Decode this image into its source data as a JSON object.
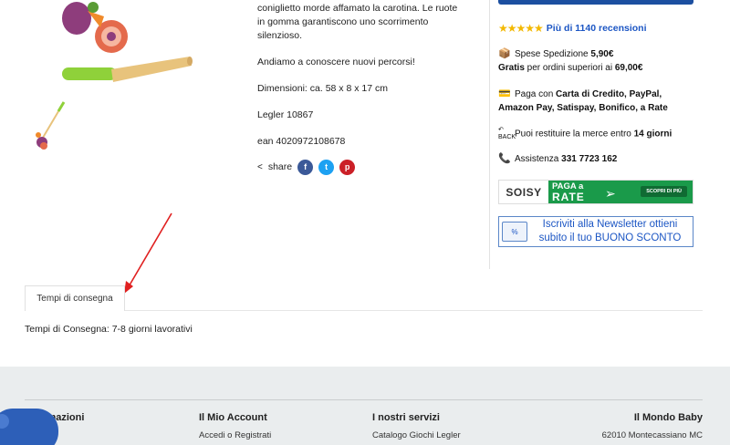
{
  "description": {
    "line1": "coniglietto morde affamato la carotina. Le ruote",
    "line2": "in gomma garantiscono uno scorrimento",
    "line3": "silenzioso.",
    "paragraph_2": "Andiamo a conoscere nuovi percorsi!",
    "dimensions": "Dimensioni: ca. 58 x 8 x 17 cm",
    "brand_code": "Legler 10867",
    "ean": "ean 4020972108678",
    "share_label": "share"
  },
  "social": [
    {
      "name": "facebook",
      "glyph": "f",
      "color": "#3b5998"
    },
    {
      "name": "twitter",
      "glyph": "t",
      "color": "#1da1f2"
    },
    {
      "name": "pinterest",
      "glyph": "p",
      "color": "#cb2027"
    }
  ],
  "sidebar": {
    "stars": "★★★★★",
    "reviews_link": "Più di 1140 recensioni",
    "shipping": {
      "prefix": "Spese Spedizione ",
      "price": "5,90€",
      "free_bold": "Gratis",
      "free_text": " per ordini superiori ai ",
      "threshold": "69,00€"
    },
    "payment": {
      "prefix": "Paga con ",
      "methods_1": "Carta di Credito, PayPal,",
      "methods_2": "Amazon Pay, Satispay, Bonifico, a Rate"
    },
    "returns": {
      "prefix": "Puoi restituire la merce entro ",
      "days": "14 giorni",
      "icon_caption": "BACK"
    },
    "support": {
      "prefix": "Assistenza ",
      "phone": "331 7723 162"
    },
    "soisy": {
      "brand": "SOISY",
      "paga": "PAGA a",
      "rate": "RATE",
      "cta": "SCOPRI DI PIÙ"
    },
    "newsletter": {
      "line1": "Iscriviti alla Newsletter ottieni",
      "line2": "subito il tuo BUONO SCONTO",
      "icon_text": "%"
    }
  },
  "tabs": {
    "label": "Tempi di consegna",
    "content": "Tempi di Consegna: 7-8 giorni lavorativi"
  },
  "footer": {
    "col1": {
      "title": "Informazioni"
    },
    "col2": {
      "title": "Il Mio Account",
      "item": "Accedi o Registrati"
    },
    "col3": {
      "title": "I nostri servizi",
      "item": "Catalogo Giochi Legler"
    },
    "col4": {
      "title": "Il Mondo Baby",
      "item": "62010 Montecassiano MC"
    }
  },
  "colors": {
    "accent": "#1c56c4",
    "arrow": "#e02020",
    "soisy_green": "#1a9a4a",
    "footer_bg": "#eaedee"
  }
}
